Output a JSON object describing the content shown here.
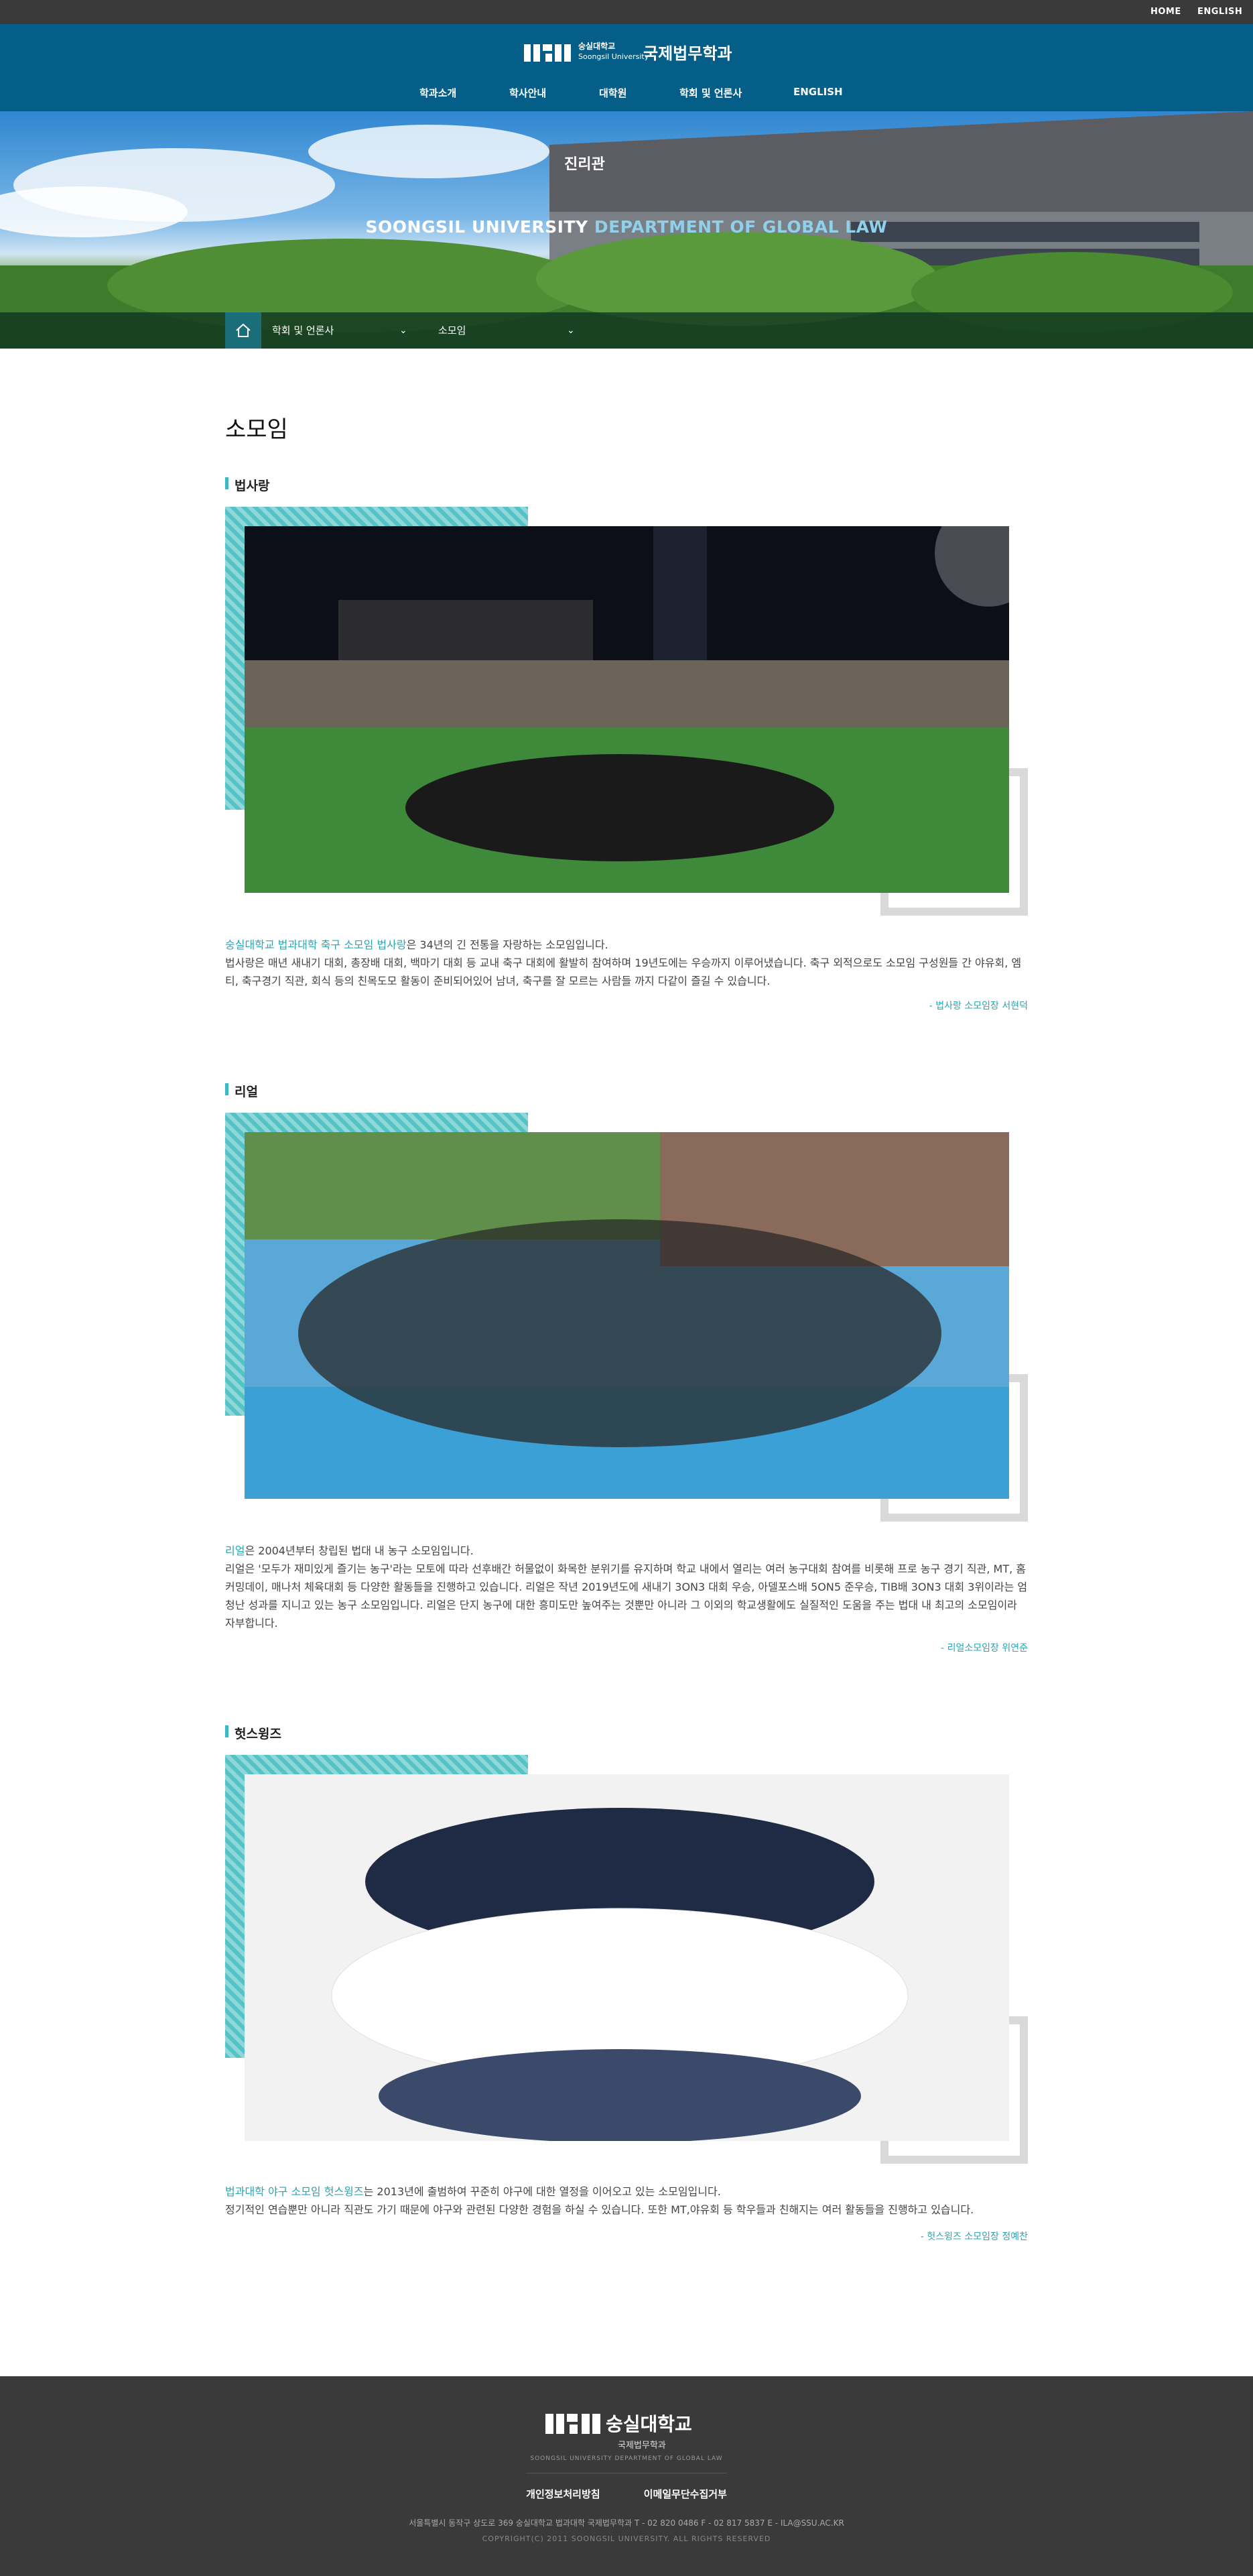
{
  "topbar": {
    "home": "HOME",
    "english": "ENGLISH"
  },
  "header": {
    "univ_kr": "숭실대학교",
    "univ_en": "Soongsil University",
    "dept": "국제법무학과",
    "nav": [
      "학과소개",
      "학사안내",
      "대학원",
      "학회 및 언론사",
      "ENGLISH"
    ]
  },
  "hero": {
    "title_main": "SOONGSIL UNIVERSITY ",
    "title_accent": "DEPARTMENT OF GLOBAL LAW",
    "building_sign": "진리관"
  },
  "breadcrumb": {
    "level1": "학회 및 언론사",
    "level2": "소모임"
  },
  "page": {
    "title": "소모임"
  },
  "sections": [
    {
      "heading": "법사랑",
      "intro_highlight": "숭실대학교 법과대학 축구 소모임 법사랑",
      "intro_rest": "은 34년의 긴 전통을 자랑하는 소모임입니다.",
      "body": "법사랑은 매년 새내기 대회, 총장배 대회, 백마기 대회 등 교내 축구 대회에 활발히 참여하며 19년도에는 우승까지 이루어냈습니다. 축구 외적으로도 소모임 구성원들 간 야유회, 엠티, 축구경기 직관, 회식 등의 친목도모 활동이 준비되어있어 남녀, 축구를 잘 모르는 사람들 까지 다같이 즐길 수 있습니다.",
      "signature": "- 법사랑 소모임장 서현덕"
    },
    {
      "heading": "리얼",
      "intro_highlight": "리얼",
      "intro_rest": "은 2004년부터 창립된 법대 내 농구 소모임입니다.",
      "body": "리얼은 '모두가 재미있게 즐기는 농구'라는 모토에 따라 선후배간 허물없이 화목한 분위기를 유지하며 학교 내에서 열리는 여러 농구대회 참여를 비롯해 프로 농구 경기 직관, MT, 홈커밍데이, 매나처 체육대회 등 다양한 활동들을 진행하고 있습니다. 리얼은 작년 2019년도에 새내기 3ON3 대회 우승, 아델포스배 5ON5 준우승, TIB배 3ON3 대회 3위이라는 엄청난 성과를 지니고 있는 농구 소모임입니다. 리얼은 단지 농구에 대한 흥미도만 높여주는 것뿐만 아니라 그 이외의 학교생활에도 실질적인 도움을 주는 법대 내 최고의 소모임이라 자부합니다.",
      "signature": "- 리얼소모임장 위연준"
    },
    {
      "heading": "헛스윙즈",
      "intro_highlight": "법과대학 야구 소모임 헛스윙즈",
      "intro_rest": "는 2013년에 출범하여 꾸준히 야구에 대한 열정을 이어오고 있는 소모임입니다.",
      "body": "정기적인 연습뿐만 아니라 직관도 가기 때문에 야구와 관련된 다양한 경험을 하실 수 있습니다. 또한 MT,야유회 등 학우들과 친해지는 여러 활동들을 진행하고 있습니다.",
      "signature": "- 헛스윙즈 소모임장 정예찬"
    }
  ],
  "footer": {
    "univ": "숭실대학교",
    "dept": "국제법무학과",
    "sub": "SOONGSIL UNIVERSITY DEPARTMENT OF GLOBAL LAW",
    "links": [
      "개인정보처리방침",
      "이메일무단수집거부"
    ],
    "address": "서울특별시 동작구 상도로 369 숭실대학교 법과대학 국제법무학과     T - 02 820 0486     F - 02 817 5837     E - ILA@SSU.AC.KR",
    "copyright": "COPYRIGHT(C) 2011 SOONGSIL UNIVERSITY. ALL RIGHTS RESERVED"
  },
  "colors": {
    "header": "#055e87",
    "accent": "#2aa5b1",
    "stripe": "#54c3c6",
    "footer": "#3a3a3a"
  }
}
